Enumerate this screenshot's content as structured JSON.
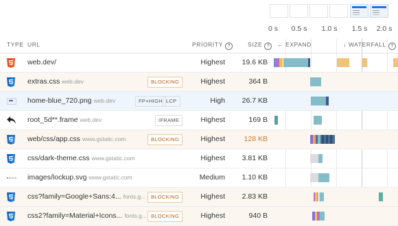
{
  "filmstrip": {
    "ticks": [
      "0 s",
      "0.5 s",
      "1.0 s",
      "1.5 s",
      "2.0 s"
    ]
  },
  "columns": {
    "type": "TYPE",
    "url": "URL",
    "priority": "PRIORITY",
    "size": "SIZE",
    "expand": "EXPAND",
    "waterfall": "WATERFALL",
    "help": "?",
    "expand_icon": "←",
    "waterfall_icon": "↓"
  },
  "colors": {
    "html": "#e44d26",
    "css": "#1565c0",
    "blocking": "#b25e14",
    "bar_main": "#7eb6c4",
    "bar_light": "#d9d9d9"
  },
  "rows": [
    {
      "icon": "html5-icon",
      "url": "web.dev/",
      "domain": "",
      "badges": [],
      "priority": "Highest",
      "size": "19.6 KB",
      "style": "normal"
    },
    {
      "icon": "css3-icon",
      "url": "extras.css",
      "domain": "web.dev",
      "badges": [
        "BLOCKING"
      ],
      "priority": "Highest",
      "size": "364 B",
      "style": "blocking"
    },
    {
      "icon": "image-icon",
      "url": "home-blue_720.png",
      "domain": "web.dev",
      "badges": [
        "FP+HIGH",
        "LCP"
      ],
      "priority": "High",
      "size": "26.7 KB",
      "style": "lcp"
    },
    {
      "icon": "redirect-arrow-icon",
      "url": "root_5d**.frame",
      "domain": "web.dev",
      "badges": [
        "IFRAME"
      ],
      "priority": "Highest",
      "size": "169 B",
      "style": "normal"
    },
    {
      "icon": "css3-icon",
      "url": "web/css/app.css",
      "domain": "www.gstatic.com",
      "badges": [
        "BLOCKING"
      ],
      "priority": "Highest",
      "size": "128 KB",
      "style": "blocking"
    },
    {
      "icon": "css3-icon",
      "url": "css/dark-theme.css",
      "domain": "www.gstatic.com",
      "badges": [],
      "priority": "Highest",
      "size": "3.81 KB",
      "style": "normal"
    },
    {
      "icon": "svg-icon",
      "url": "images/lockup.svg",
      "domain": "www.gstatic.com",
      "badges": [],
      "priority": "Medium",
      "size": "1.10 KB",
      "style": "normal"
    },
    {
      "icon": "css3-icon",
      "url": "css?family=Google+Sans:4...",
      "domain": "fonts.g...",
      "badges": [
        "BLOCKING"
      ],
      "priority": "Highest",
      "size": "2.83 KB",
      "style": "blocking"
    },
    {
      "icon": "css3-icon",
      "url": "css2?family=Material+Icons...",
      "domain": "fonts.g...",
      "badges": [
        "BLOCKING"
      ],
      "priority": "Highest",
      "size": "940 B",
      "style": "blocking"
    }
  ]
}
